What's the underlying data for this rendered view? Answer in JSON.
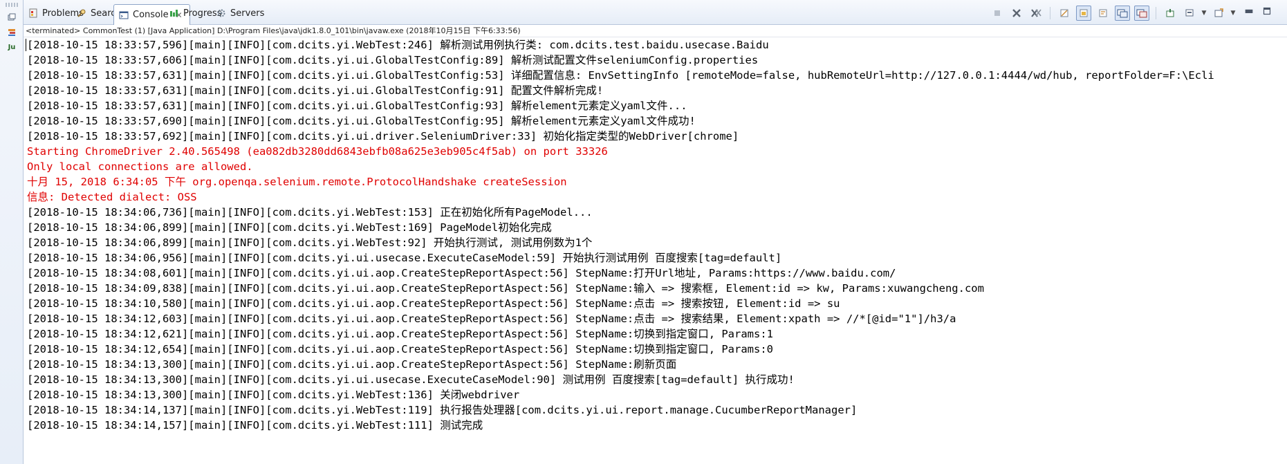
{
  "tabs": [
    {
      "label": "Problems",
      "icon": "problems-icon",
      "active": false
    },
    {
      "label": "Search",
      "icon": "search-icon",
      "active": false
    },
    {
      "label": "Console",
      "icon": "console-icon",
      "active": true
    },
    {
      "label": "Progress",
      "icon": "progress-icon",
      "active": false
    },
    {
      "label": "Servers",
      "icon": "servers-icon",
      "active": false
    }
  ],
  "toolbar": {
    "icons": [
      "terminate-icon",
      "remove-launch-icon",
      "remove-all-terminated-icon",
      "clear-console-icon",
      "scroll-lock-icon",
      "word-wrap-icon",
      "show-on-stdout-icon",
      "show-on-stderr-icon",
      "pin-console-icon",
      "display-selected-console-icon",
      "open-console-icon",
      "minimize-icon",
      "maximize-icon"
    ]
  },
  "side": {
    "icons": [
      "restore-icon",
      "outline-icon",
      "junit-icon"
    ],
    "junit_label": "Ju"
  },
  "status": {
    "terminated": "<terminated> CommonTest (1) [Java Application] D:\\Program Files\\java\\jdk1.8.0_101\\bin\\javaw.exe (2018年10月15日 下午6:33:56)"
  },
  "colors": {
    "stdout": "#000000",
    "stderr": "#e00000"
  },
  "console": {
    "lines": [
      {
        "text": "[2018-10-15 18:33:57,596][main][INFO][com.dcits.yi.WebTest:246] 解析测试用例执行类: com.dcits.test.baidu.usecase.Baidu",
        "err": false
      },
      {
        "text": "[2018-10-15 18:33:57,606][main][INFO][com.dcits.yi.ui.GlobalTestConfig:89] 解析测试配置文件seleniumConfig.properties",
        "err": false
      },
      {
        "text": "[2018-10-15 18:33:57,631][main][INFO][com.dcits.yi.ui.GlobalTestConfig:53] 详细配置信息: EnvSettingInfo [remoteMode=false, hubRemoteUrl=http://127.0.0.1:4444/wd/hub, reportFolder=F:\\Ecli",
        "err": false
      },
      {
        "text": "[2018-10-15 18:33:57,631][main][INFO][com.dcits.yi.ui.GlobalTestConfig:91] 配置文件解析完成!",
        "err": false
      },
      {
        "text": "[2018-10-15 18:33:57,631][main][INFO][com.dcits.yi.ui.GlobalTestConfig:93] 解析element元素定义yaml文件...",
        "err": false
      },
      {
        "text": "[2018-10-15 18:33:57,690][main][INFO][com.dcits.yi.ui.GlobalTestConfig:95] 解析element元素定义yaml文件成功!",
        "err": false
      },
      {
        "text": "[2018-10-15 18:33:57,692][main][INFO][com.dcits.yi.ui.driver.SeleniumDriver:33] 初始化指定类型的WebDriver[chrome]",
        "err": false
      },
      {
        "text": "Starting ChromeDriver 2.40.565498 (ea082db3280dd6843ebfb08a625e3eb905c4f5ab) on port 33326",
        "err": true
      },
      {
        "text": "Only local connections are allowed.",
        "err": true
      },
      {
        "text": "十月 15, 2018 6:34:05 下午 org.openqa.selenium.remote.ProtocolHandshake createSession",
        "err": true
      },
      {
        "text": "信息: Detected dialect: OSS",
        "err": true
      },
      {
        "text": "[2018-10-15 18:34:06,736][main][INFO][com.dcits.yi.WebTest:153] 正在初始化所有PageModel...",
        "err": false
      },
      {
        "text": "[2018-10-15 18:34:06,899][main][INFO][com.dcits.yi.WebTest:169] PageModel初始化完成",
        "err": false
      },
      {
        "text": "[2018-10-15 18:34:06,899][main][INFO][com.dcits.yi.WebTest:92] 开始执行测试, 测试用例数为1个",
        "err": false
      },
      {
        "text": "[2018-10-15 18:34:06,956][main][INFO][com.dcits.yi.ui.usecase.ExecuteCaseModel:59] 开始执行测试用例 百度搜索[tag=default]",
        "err": false
      },
      {
        "text": "[2018-10-15 18:34:08,601][main][INFO][com.dcits.yi.ui.aop.CreateStepReportAspect:56] StepName:打开Url地址, Params:https://www.baidu.com/",
        "err": false
      },
      {
        "text": "[2018-10-15 18:34:09,838][main][INFO][com.dcits.yi.ui.aop.CreateStepReportAspect:56] StepName:输入 => 搜索框, Element:id => kw, Params:xuwangcheng.com",
        "err": false
      },
      {
        "text": "[2018-10-15 18:34:10,580][main][INFO][com.dcits.yi.ui.aop.CreateStepReportAspect:56] StepName:点击 => 搜索按钮, Element:id => su",
        "err": false
      },
      {
        "text": "[2018-10-15 18:34:12,603][main][INFO][com.dcits.yi.ui.aop.CreateStepReportAspect:56] StepName:点击 => 搜索结果, Element:xpath => //*[@id=\"1\"]/h3/a",
        "err": false
      },
      {
        "text": "[2018-10-15 18:34:12,621][main][INFO][com.dcits.yi.ui.aop.CreateStepReportAspect:56] StepName:切换到指定窗口, Params:1",
        "err": false
      },
      {
        "text": "[2018-10-15 18:34:12,654][main][INFO][com.dcits.yi.ui.aop.CreateStepReportAspect:56] StepName:切换到指定窗口, Params:0",
        "err": false
      },
      {
        "text": "[2018-10-15 18:34:13,300][main][INFO][com.dcits.yi.ui.aop.CreateStepReportAspect:56] StepName:刷新页面",
        "err": false
      },
      {
        "text": "[2018-10-15 18:34:13,300][main][INFO][com.dcits.yi.ui.usecase.ExecuteCaseModel:90] 测试用例 百度搜索[tag=default] 执行成功!",
        "err": false
      },
      {
        "text": "[2018-10-15 18:34:13,300][main][INFO][com.dcits.yi.WebTest:136] 关闭webdriver",
        "err": false
      },
      {
        "text": "[2018-10-15 18:34:14,137][main][INFO][com.dcits.yi.WebTest:119] 执行报告处理器[com.dcits.yi.ui.report.manage.CucumberReportManager]",
        "err": false
      },
      {
        "text": "[2018-10-15 18:34:14,157][main][INFO][com.dcits.yi.WebTest:111] 测试完成",
        "err": false
      }
    ]
  }
}
